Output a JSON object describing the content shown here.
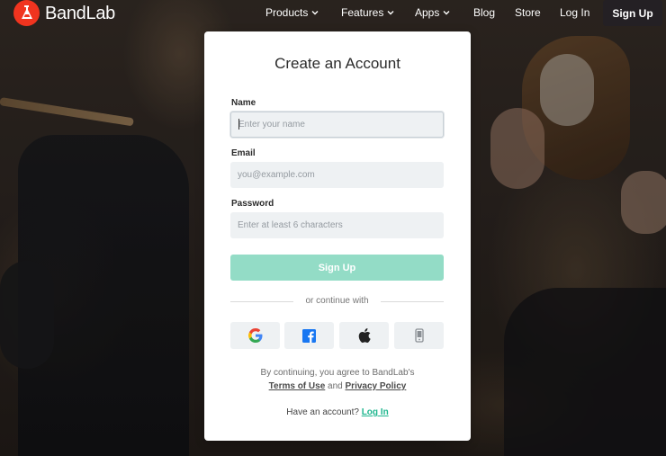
{
  "brand": {
    "name": "BandLab",
    "color": "#f0341f"
  },
  "nav": {
    "items": [
      {
        "label": "Products",
        "dropdown": true
      },
      {
        "label": "Features",
        "dropdown": true
      },
      {
        "label": "Apps",
        "dropdown": true
      },
      {
        "label": "Blog",
        "dropdown": false
      },
      {
        "label": "Store",
        "dropdown": false
      },
      {
        "label": "Log In",
        "dropdown": false
      }
    ],
    "signup_label": "Sign Up"
  },
  "form": {
    "title": "Create an Account",
    "name_label": "Name",
    "name_placeholder": "Enter your name",
    "name_value": "",
    "email_label": "Email",
    "email_placeholder": "you@example.com",
    "email_value": "",
    "password_label": "Password",
    "password_placeholder": "Enter at least 6 characters",
    "password_value": "",
    "submit_label": "Sign Up",
    "submit_color": "#93dcc6",
    "divider_text": "or continue with",
    "social": [
      "google-icon",
      "facebook-icon",
      "apple-icon",
      "phone-icon"
    ],
    "terms_prefix": "By continuing, you agree to BandLab's",
    "terms_of_use": "Terms of Use",
    "terms_and": "and",
    "privacy_policy": "Privacy Policy",
    "have_account": "Have an account?",
    "login_link": "Log In",
    "link_color": "#1eb68e"
  }
}
